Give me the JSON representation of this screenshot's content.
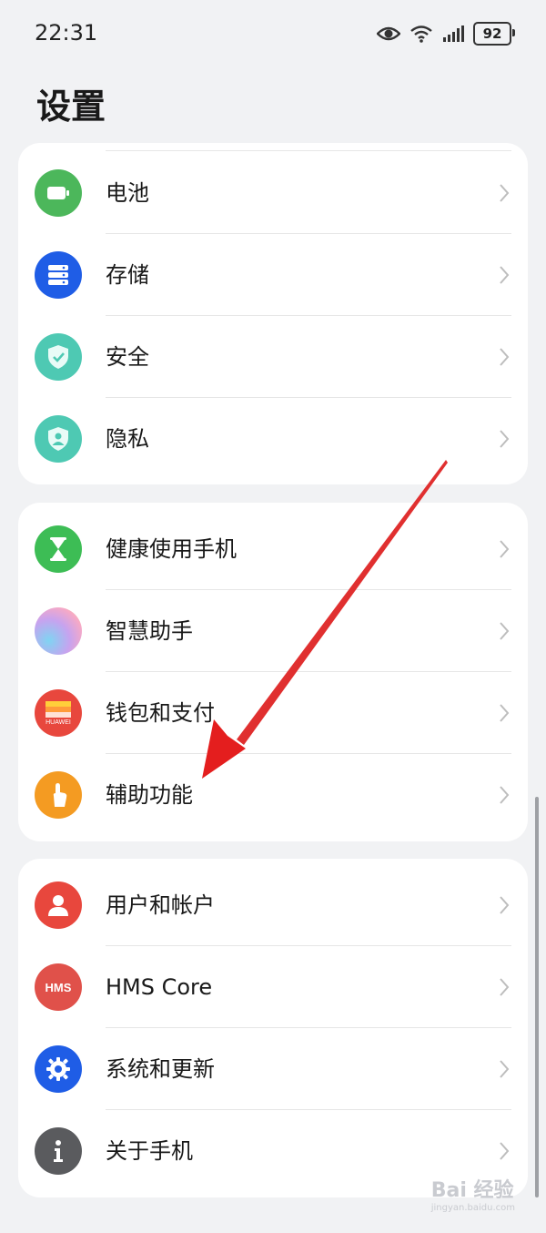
{
  "status": {
    "time": "22:31",
    "battery": "92"
  },
  "page": {
    "title": "设置"
  },
  "groups": [
    {
      "items": [
        {
          "label": "电池",
          "icon": "battery-icon",
          "color": "#4cb75b"
        },
        {
          "label": "存储",
          "icon": "storage-icon",
          "color": "#1f5de6"
        },
        {
          "label": "安全",
          "icon": "shield-check-icon",
          "color": "#4ec9b3"
        },
        {
          "label": "隐私",
          "icon": "privacy-shield-icon",
          "color": "#4ec9b3"
        }
      ]
    },
    {
      "items": [
        {
          "label": "健康使用手机",
          "icon": "hourglass-icon",
          "color": "#3dbd55"
        },
        {
          "label": "智慧助手",
          "icon": "smart-assistant-icon",
          "color": "#c9a8f0"
        },
        {
          "label": "钱包和支付",
          "icon": "wallet-icon",
          "color": "#e8473d"
        },
        {
          "label": "辅助功能",
          "icon": "hand-tap-icon",
          "color": "#f49b22"
        }
      ]
    },
    {
      "items": [
        {
          "label": "用户和帐户",
          "icon": "user-icon",
          "color": "#e8473d"
        },
        {
          "label": "HMS Core",
          "icon": "hms-icon",
          "color": "#e0514a"
        },
        {
          "label": "系统和更新",
          "icon": "gear-icon",
          "color": "#1f5de6"
        },
        {
          "label": "关于手机",
          "icon": "info-icon",
          "color": "#5a5b5e"
        }
      ]
    }
  ],
  "icon_text": {
    "wallet": "HUAWEI",
    "hms": "HMS"
  },
  "watermark": {
    "brand": "Bai 经验",
    "url": "jingyan.baidu.com"
  },
  "annotation_color": "#e41e1e"
}
